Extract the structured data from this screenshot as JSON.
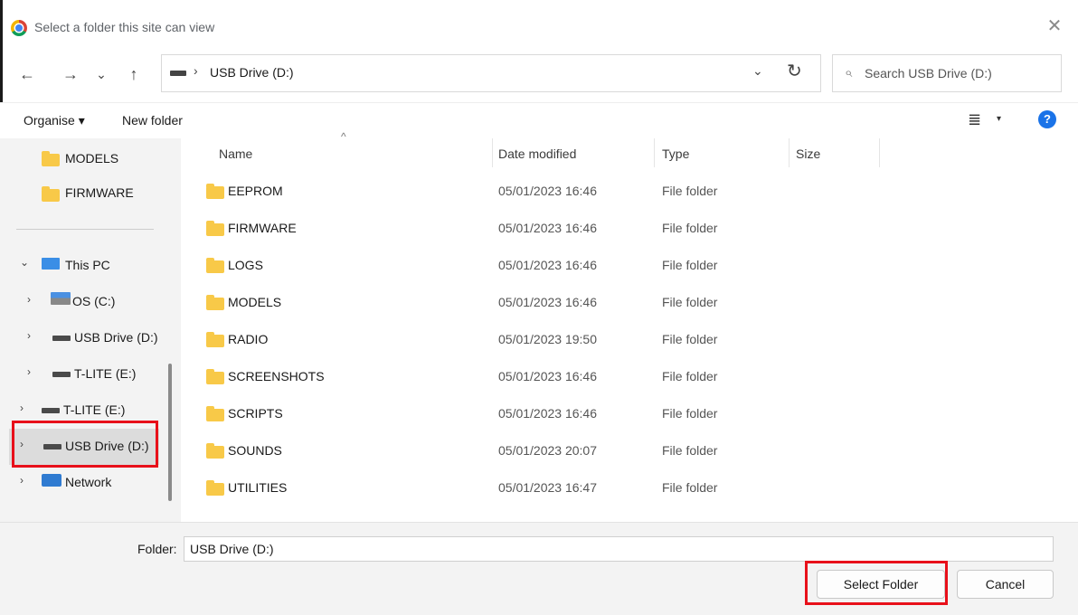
{
  "titlebar": {
    "title": "Select a folder this site can view",
    "close": "✕"
  },
  "nav": {
    "back": "←",
    "forward": "→",
    "recent": "⌄",
    "up": "↑"
  },
  "address": {
    "separator": "›",
    "path": "USB Drive (D:)",
    "dropdown": "⌄",
    "refresh": "↻"
  },
  "search": {
    "placeholder": "Search USB Drive (D:)",
    "icon": "search-icon"
  },
  "commandbar": {
    "organise": "Organise ▾",
    "new_folder": "New folder",
    "view": "≣",
    "view_caret": "▾",
    "help": "?"
  },
  "sidebar": {
    "items": [
      {
        "label": "MODELS"
      },
      {
        "label": "FIRMWARE"
      },
      {
        "label": "This PC"
      },
      {
        "label": "OS (C:)"
      },
      {
        "label": "USB Drive (D:)"
      },
      {
        "label": "T-LITE (E:)"
      },
      {
        "label": "T-LITE (E:)"
      },
      {
        "label": "USB Drive (D:)"
      },
      {
        "label": "Network"
      }
    ],
    "chevron_expanded": "⌄",
    "chevron_collapsed": "›"
  },
  "columns": {
    "name": "Name",
    "date": "Date modified",
    "type": "Type",
    "size": "Size",
    "sort_caret": "^"
  },
  "files": [
    {
      "name": "EEPROM",
      "date": "05/01/2023 16:46",
      "type": "File folder"
    },
    {
      "name": "FIRMWARE",
      "date": "05/01/2023 16:46",
      "type": "File folder"
    },
    {
      "name": "LOGS",
      "date": "05/01/2023 16:46",
      "type": "File folder"
    },
    {
      "name": "MODELS",
      "date": "05/01/2023 16:46",
      "type": "File folder"
    },
    {
      "name": "RADIO",
      "date": "05/01/2023 19:50",
      "type": "File folder"
    },
    {
      "name": "SCREENSHOTS",
      "date": "05/01/2023 16:46",
      "type": "File folder"
    },
    {
      "name": "SCRIPTS",
      "date": "05/01/2023 16:46",
      "type": "File folder"
    },
    {
      "name": "SOUNDS",
      "date": "05/01/2023 20:07",
      "type": "File folder"
    },
    {
      "name": "UTILITIES",
      "date": "05/01/2023 16:47",
      "type": "File folder"
    }
  ],
  "footer": {
    "folder_label": "Folder:",
    "folder_value": "USB Drive (D:)",
    "select_button": "Select Folder",
    "cancel_button": "Cancel"
  },
  "colors": {
    "highlight": "#e8101a",
    "folder": "#f8c948",
    "accent": "#1a73e8"
  }
}
